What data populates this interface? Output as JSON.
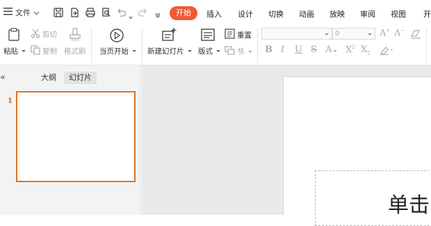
{
  "menu": {
    "file_label": "文件",
    "tabs": [
      {
        "label": "开始",
        "active": true
      },
      {
        "label": "插入"
      },
      {
        "label": "设计"
      },
      {
        "label": "切换"
      },
      {
        "label": "动画"
      },
      {
        "label": "放映"
      },
      {
        "label": "审阅"
      },
      {
        "label": "视图"
      },
      {
        "label": "开"
      }
    ]
  },
  "ribbon": {
    "paste": "粘贴",
    "cut": "剪切",
    "copy": "复制",
    "format_painter": "格式刷",
    "play_from_current": "当页开始",
    "new_slide": "新建幻灯片",
    "layout": "版式",
    "reset": "重置",
    "section": "节",
    "font_name": "",
    "font_size": "0"
  },
  "left_pane": {
    "outline_tab": "大纲",
    "slides_tab": "幻灯片",
    "slide_number": "1"
  },
  "slide": {
    "title_text": "单击"
  },
  "colors": {
    "accent": "#ef5a35",
    "thumb_border": "#d9732a"
  }
}
